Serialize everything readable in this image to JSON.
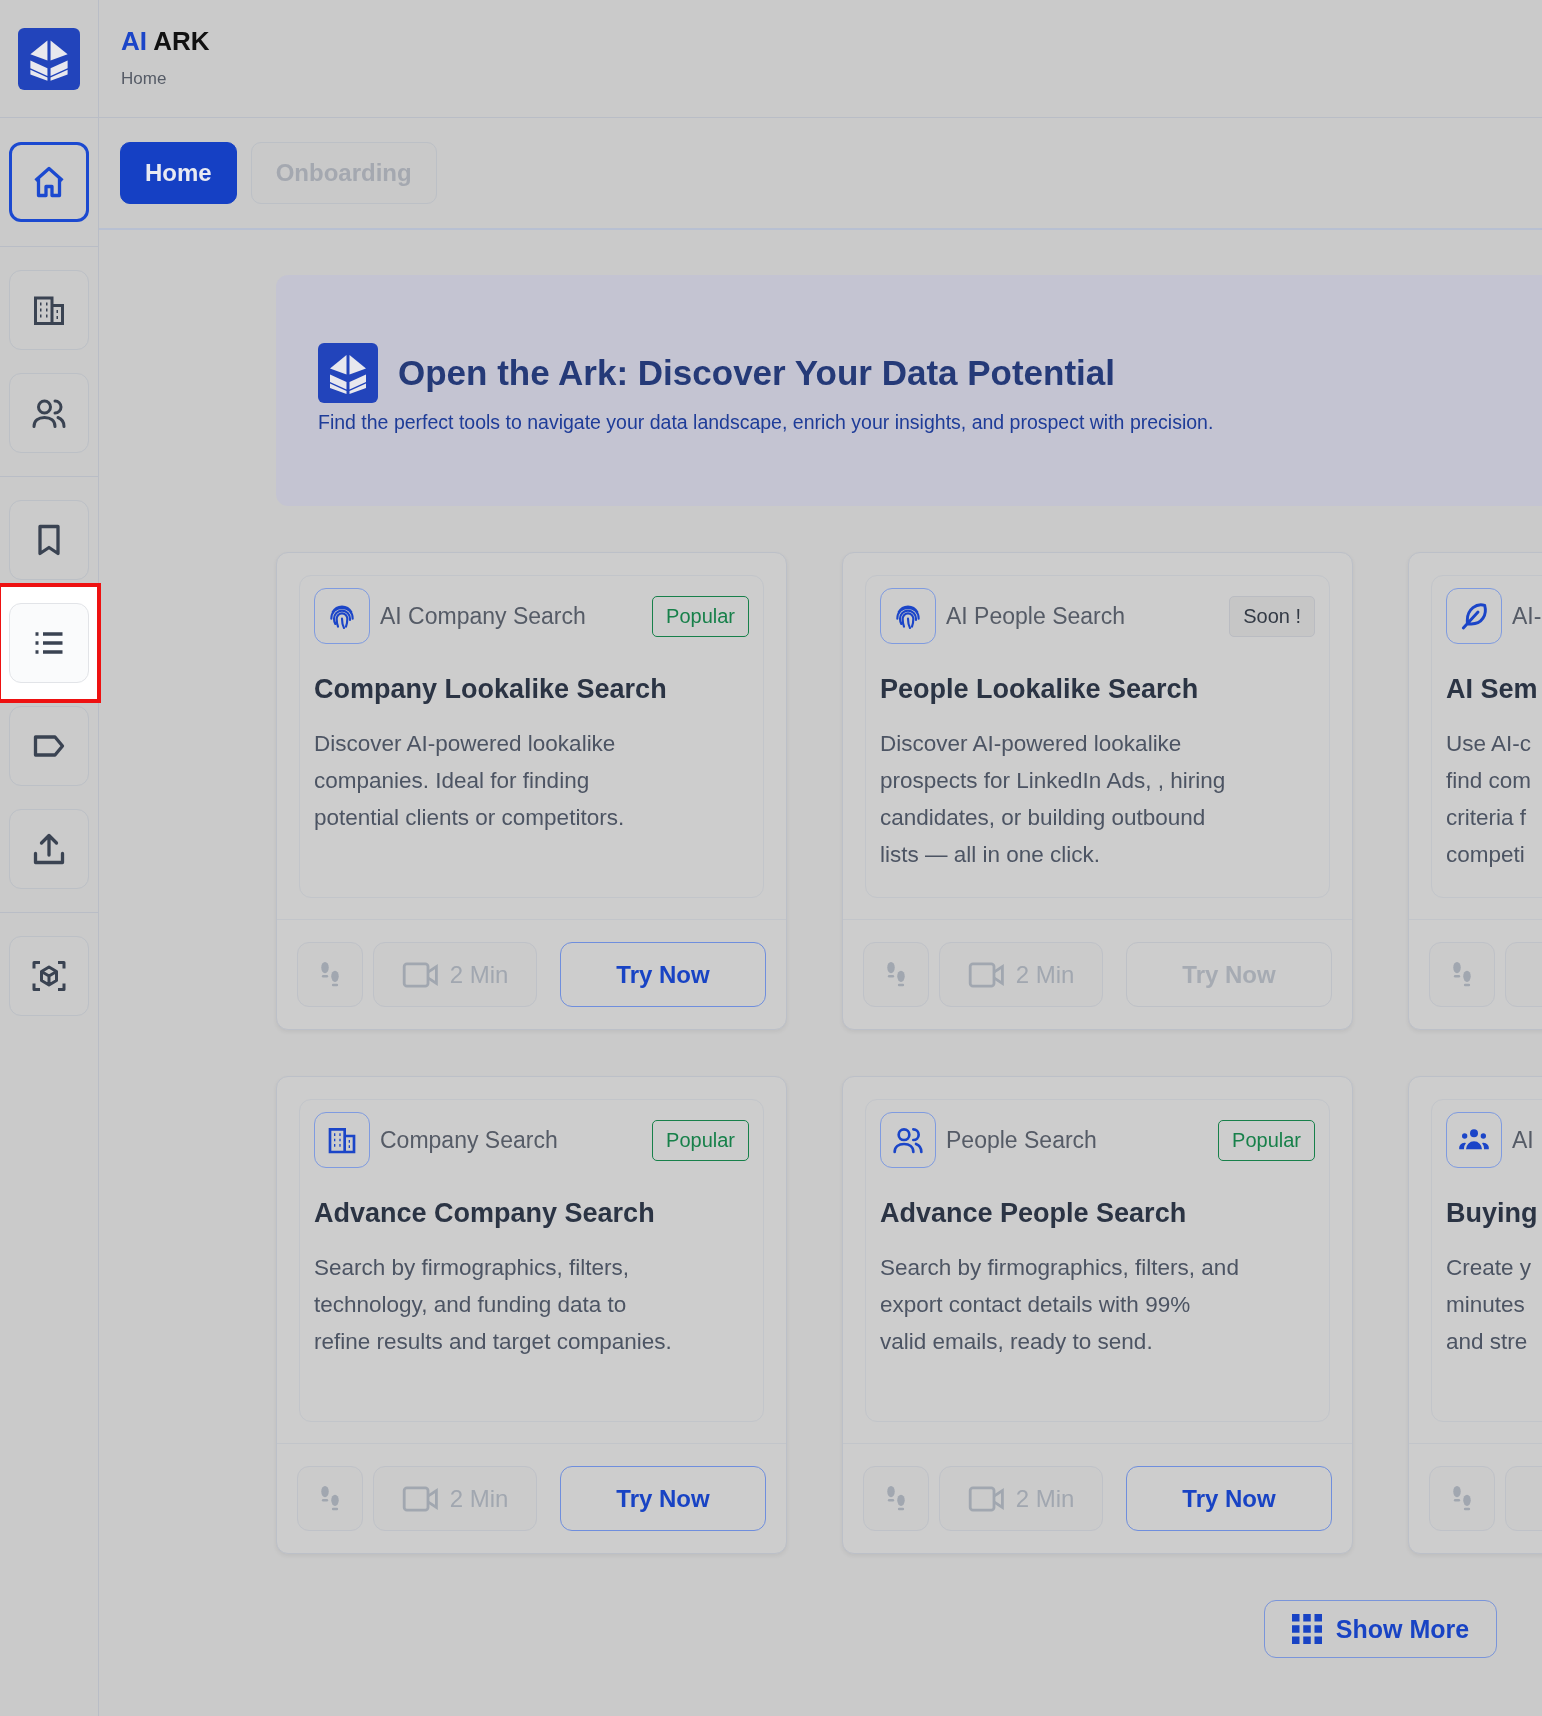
{
  "brand": {
    "prefix": "AI",
    "name": "ARK",
    "breadcrumb": "Home"
  },
  "sidebar": {
    "groups": [
      [
        {
          "selected": true,
          "highlighted": false
        }
      ],
      [
        {
          "selected": false,
          "highlighted": false
        },
        {
          "selected": false,
          "highlighted": false
        }
      ],
      [
        {
          "selected": false,
          "highlighted": false
        },
        {
          "selected": false,
          "highlighted": true
        },
        {
          "selected": false,
          "highlighted": false
        },
        {
          "selected": false,
          "highlighted": false
        }
      ],
      [
        {
          "selected": false,
          "highlighted": false
        }
      ]
    ]
  },
  "tabs": [
    {
      "label": "Home",
      "selected": true
    },
    {
      "label": "Onboarding",
      "selected": false
    }
  ],
  "banner": {
    "title": "Open the Ark: Discover Your Data Potential",
    "subtitle": "Find the perfect tools to navigate your data landscape, enrich your insights, and prospect with precision."
  },
  "cards": [
    {
      "category": "AI Company Search",
      "badge": {
        "kind": "popular",
        "label": "Popular"
      },
      "title": "Company Lookalike Search",
      "description_lines": [
        "Discover AI-powered lookalike",
        "companies. Ideal for finding",
        "potential clients or competitors."
      ],
      "duration": "2 Min",
      "try_label": "Try Now",
      "try_disabled": false
    },
    {
      "category": "AI People Search",
      "badge": {
        "kind": "soon",
        "label": "Soon !"
      },
      "title": "People Lookalike Search",
      "description_lines": [
        "Discover AI-powered lookalike",
        "prospects for LinkedIn Ads, , hiring",
        "candidates, or building outbound",
        "lists — all in one click."
      ],
      "duration": "2 Min",
      "try_label": "Try Now",
      "try_disabled": true
    },
    {
      "category": "AI-",
      "title": "AI Sem",
      "description_lines": [
        "Use AI-c",
        "find com",
        "criteria f",
        "competi"
      ]
    },
    {
      "category": "Company Search",
      "badge": {
        "kind": "popular",
        "label": "Popular"
      },
      "title": "Advance Company Search",
      "description_lines": [
        "Search by firmographics, filters,",
        "technology, and funding data to",
        "refine results and target companies."
      ],
      "duration": "2 Min",
      "try_label": "Try Now",
      "try_disabled": false
    },
    {
      "category": "People Search",
      "badge": {
        "kind": "popular",
        "label": "Popular"
      },
      "title": "Advance People Search",
      "description_lines": [
        "Search by firmographics, filters, and",
        "export contact details with 99%",
        "valid emails, ready to send."
      ],
      "duration": "2 Min",
      "try_label": "Try Now",
      "try_disabled": false
    },
    {
      "category": "AI",
      "title": "Buying",
      "description_lines": [
        "Create y",
        "minutes",
        "and stre"
      ]
    }
  ],
  "show_more": "Show More"
}
